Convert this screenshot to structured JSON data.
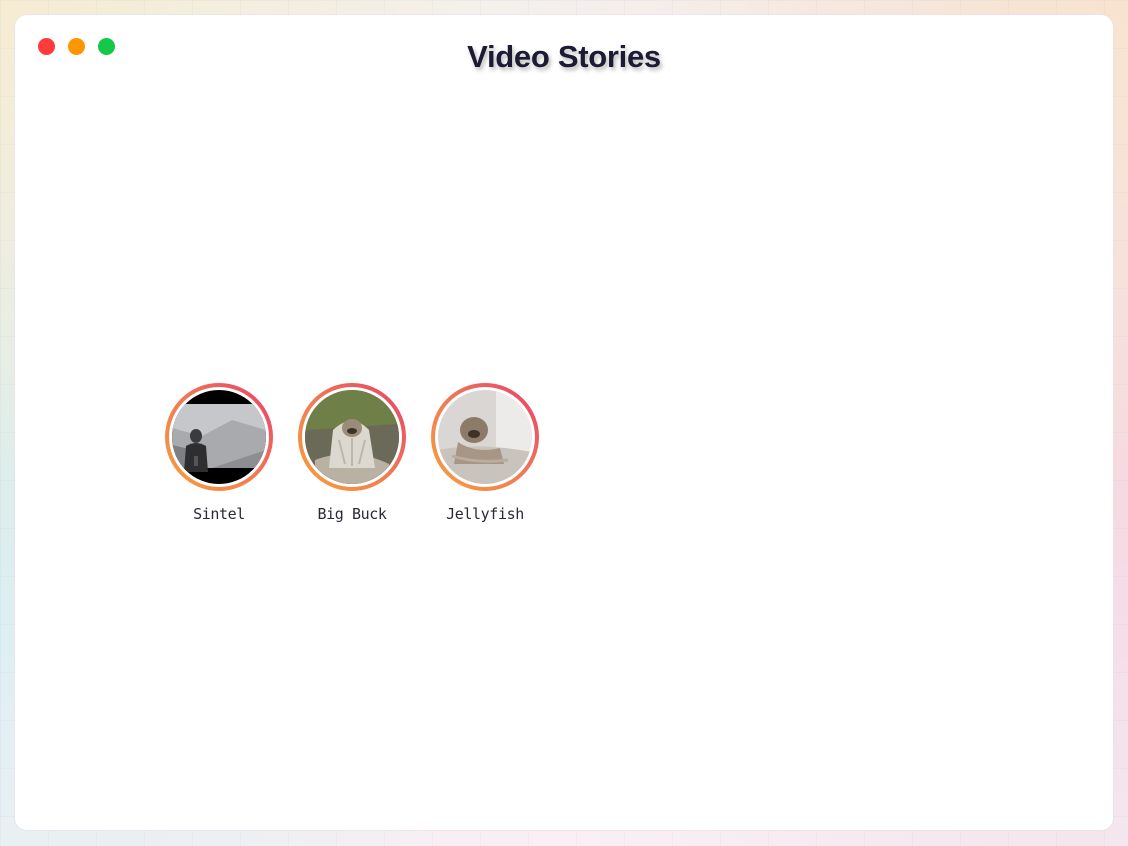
{
  "window": {
    "title": "Video Stories",
    "controls": [
      {
        "name": "close",
        "color": "#ff3b3b"
      },
      {
        "name": "minimize",
        "color": "#ff9500"
      },
      {
        "name": "zoom",
        "color": "#14c94a"
      }
    ]
  },
  "stories": [
    {
      "label": "Sintel",
      "thumbnail_icon": "figure-on-ice-thumbnail"
    },
    {
      "label": "Big Buck",
      "thumbnail_icon": "pug-in-blanket-thumbnail"
    },
    {
      "label": "Jellyfish",
      "thumbnail_icon": "pug-lying-down-thumbnail"
    }
  ],
  "colors": {
    "ring_gradient_start": "#f8a13a",
    "ring_gradient_end": "#e8406a",
    "title_text": "#1c1b33"
  }
}
